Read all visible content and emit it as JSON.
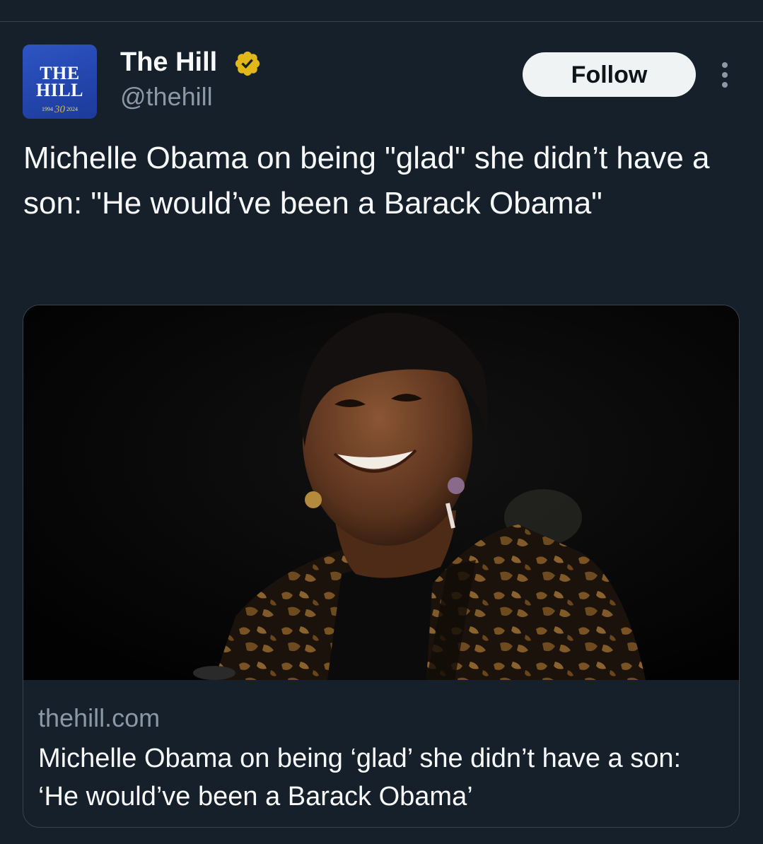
{
  "post": {
    "author": {
      "display_name": "The Hill",
      "handle": "@thehill",
      "verified_badge_icon": "verified-gold-check-icon",
      "verified_color": "#e2b719",
      "avatar": {
        "line1": "THE",
        "line2": "HILL",
        "year_start": "1994",
        "anniversary": "30",
        "year_end": "2024"
      }
    },
    "follow_label": "Follow",
    "more_icon": "more-vertical-icon",
    "text": "Michelle Obama on being \"glad\" she didn’t have a son: \"He would’ve been a Barack Obama\""
  },
  "link_card": {
    "domain": "thehill.com",
    "title": "Michelle Obama on being ‘glad’ she didn’t have a son: ‘He would’ve been a Barack Obama’"
  },
  "colors": {
    "background": "#15202b",
    "secondary_text": "#8b98a5",
    "border": "#38444d",
    "follow_bg": "#eff3f4"
  }
}
